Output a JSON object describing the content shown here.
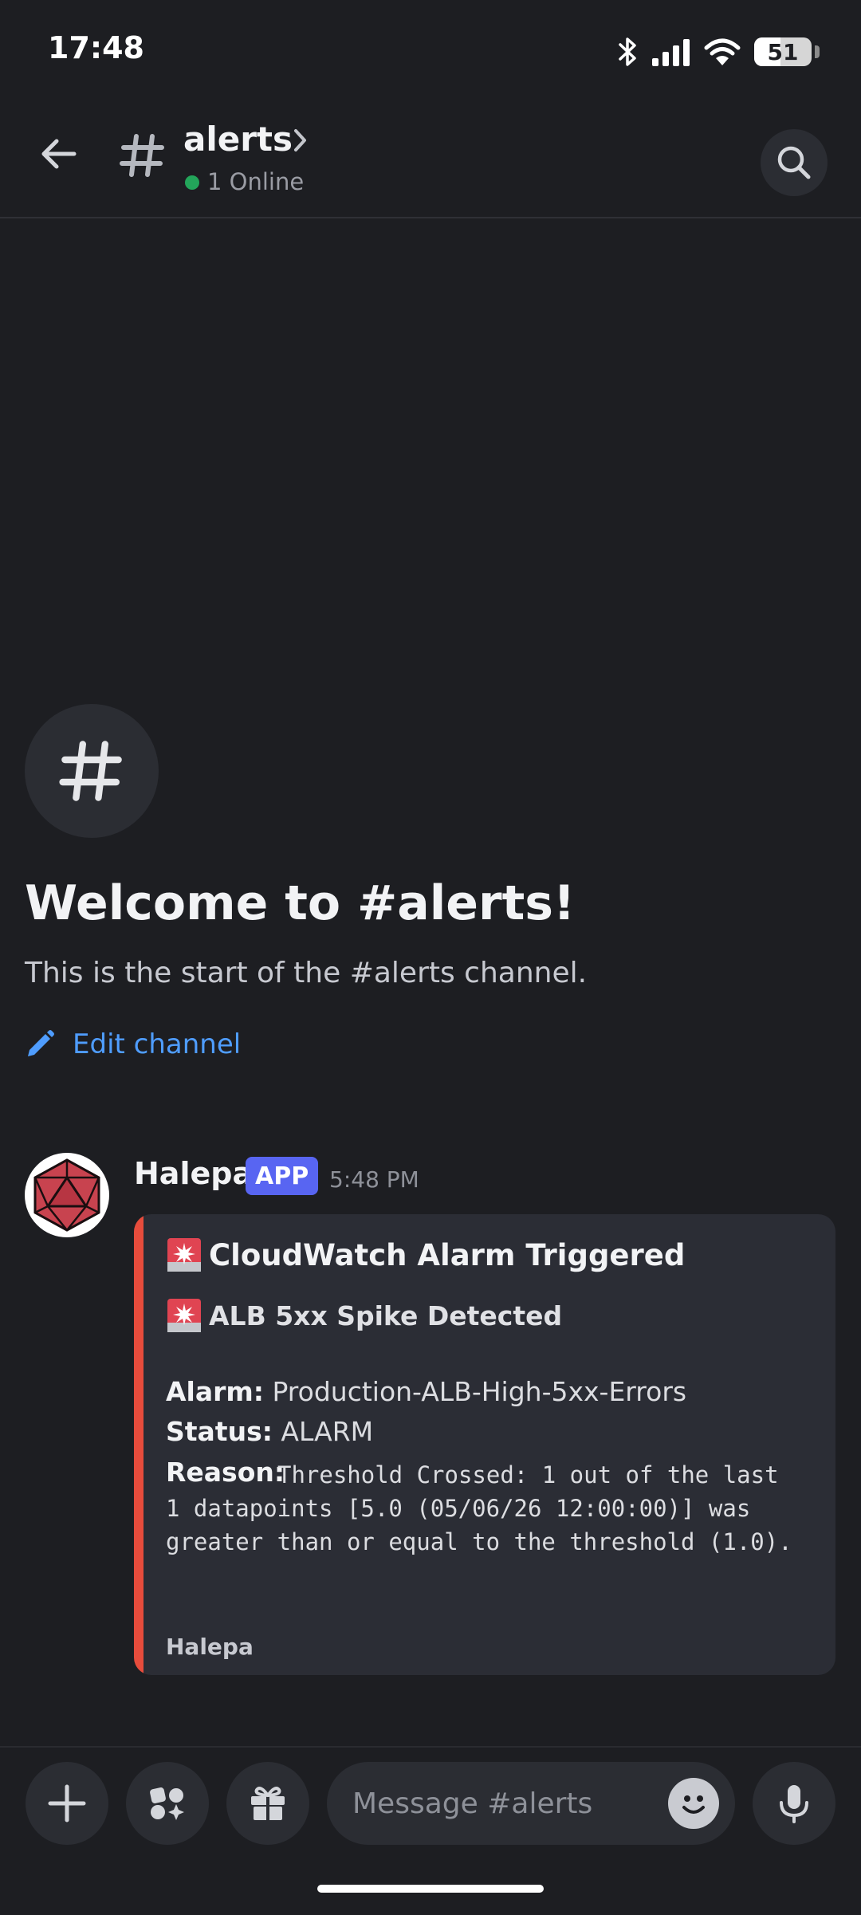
{
  "status_bar": {
    "time": "17:48",
    "battery": "51"
  },
  "header": {
    "channel_name": "alerts",
    "online_status": "1 Online"
  },
  "welcome": {
    "title": "Welcome to #alerts!",
    "subtitle": "This is the start of the #alerts channel.",
    "edit_label": "Edit channel"
  },
  "message": {
    "author": "Halepa",
    "badge": "APP",
    "timestamp": "5:48 PM",
    "embed": {
      "title": "CloudWatch Alarm Triggered",
      "subtitle": "ALB 5xx Spike Detected",
      "alarm_label": "Alarm:",
      "alarm_value": "Production-ALB-High-5xx-Errors",
      "status_label": "Status:",
      "status_value": "ALARM",
      "reason_label": "Reason:",
      "reason_value": "Threshold Crossed: 1 out of the last 1 datapoints [5.0 (05/06/26 12:00:00)] was greater than or equal to the threshold (1.0).",
      "footer": "Halepa",
      "accent_color": "#e74c3c"
    }
  },
  "composer": {
    "placeholder": "Message #alerts"
  },
  "colors": {
    "background": "#1d1e22",
    "accent": "#5865f2",
    "link": "#4f9dff",
    "online": "#23a55a"
  }
}
